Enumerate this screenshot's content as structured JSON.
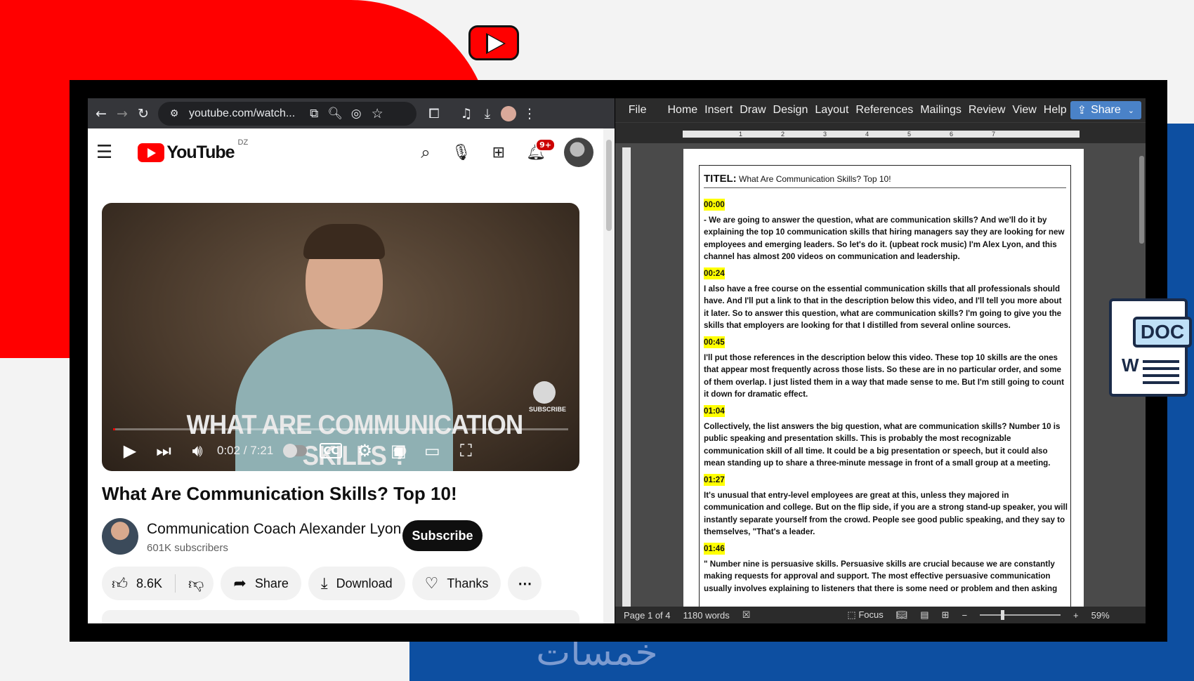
{
  "browser": {
    "url": "youtube.com/watch...",
    "youtube_brand": "YouTube",
    "region": "DZ",
    "notifications": "9+",
    "video": {
      "overlay_title": "WHAT ARE COMMUNICATION SKILLS ?",
      "overlay_badge": "SUBSCRIBE",
      "time": "0:02 / 7:21",
      "progress_fraction": 0.005,
      "title": "What Are Communication Skills? Top 10!"
    },
    "channel": {
      "name": "Communication Coach Alexander Lyon",
      "subscribers": "601K subscribers",
      "subscribe_label": "Subscribe"
    },
    "actions": {
      "likes": "8.6K",
      "share": "Share",
      "download": "Download",
      "thanks": "Thanks",
      "more": "⋯"
    }
  },
  "word": {
    "menus": [
      "File",
      "Home",
      "Insert",
      "Draw",
      "Design",
      "Layout",
      "References",
      "Mailings",
      "Review",
      "View",
      "Help"
    ],
    "share_label": "Share",
    "doc_title_label": "TITEL:",
    "doc_title": "What Are Communication Skills? Top 10!",
    "transcript": [
      {
        "time": "00:00",
        "text": "- We are going to answer the question, what are communication skills? And we'll do it by explaining the top 10 communication skills that hiring managers say they are looking for new employees and emerging leaders. So let's do it. (upbeat rock music) I'm Alex Lyon, and this channel has almost 200 videos on communication and leadership."
      },
      {
        "time": "00:24",
        "text": "I also have a free course on the essential communication skills that all professionals should have. And I'll put a link to that in the description below this video, and I'll tell you more about it later. So to answer this question, what are communication skills? I'm going to give you the skills that employers are looking for that I distilled from several online sources."
      },
      {
        "time": "00:45",
        "text": "I'll put those references in the description below this video. These top 10 skills are the ones that appear most frequently across those lists. So these are in no particular order, and some of them overlap. I just listed them in a way that made sense to me. But I'm still going to count it down for dramatic effect."
      },
      {
        "time": "01:04",
        "text": "Collectively, the list answers the big question, what are communication skills? Number 10 is public speaking and presentation skills. This is probably the most recognizable communication skill of all time. It could be a big presentation or speech, but it could also mean standing up to share a three-minute message in front of a small group at a meeting."
      },
      {
        "time": "01:27",
        "text": "It's unusual that entry-level employees are great at this, unless they majored in communication and college. But on the flip side, if you are a strong stand-up speaker, you will instantly separate yourself from the crowd. People see good public speaking, and they say to themselves, \"That's a leader."
      },
      {
        "time": "01:46",
        "text": "\" Number nine is persuasive skills. Persuasive skills are crucial because we are constantly making requests for approval and support. The most effective persuasive communication usually involves explaining to listeners that there is some need or problem and then asking"
      }
    ],
    "status": {
      "page": "Page 1 of 4",
      "words": "1180 words",
      "focus": "Focus",
      "zoom": "59%"
    }
  },
  "decor": {
    "doc_badge": "DOC",
    "doc_letter": "W",
    "watermark": "خمسات"
  }
}
